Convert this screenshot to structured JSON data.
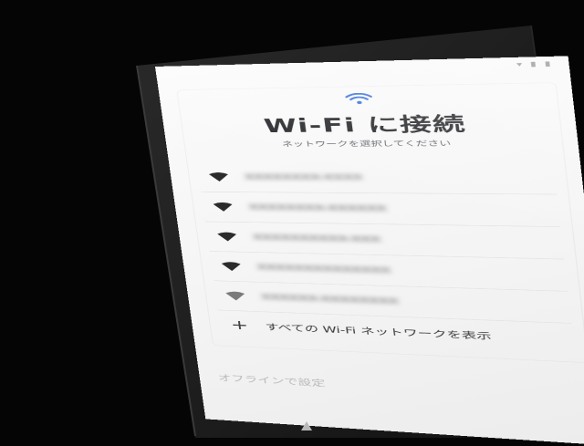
{
  "screen": {
    "status_icons": "▾ ▮ ▮",
    "icons": {
      "header": "wifi-icon",
      "network": "wifi-lock-icon",
      "add": "plus-icon",
      "nav": "back-triangle-icon"
    },
    "accent_color": "#2f6bd8",
    "title": "Wi-Fi に接続",
    "subtitle": "ネットワークを選択してください",
    "networks": [
      {
        "ssid": "XXXXXXXX-XXXX"
      },
      {
        "ssid": "XXXXXXXX-XXXXXX"
      },
      {
        "ssid": "XXXXXXXXXX-XXX"
      },
      {
        "ssid": "XXXXXXXXXXXXXX"
      },
      {
        "ssid": "XXXXXX-XXXXXXXX"
      }
    ],
    "see_all_label": "すべての Wi-Fi ネットワークを表示",
    "offline_label": "オフラインで設定"
  }
}
